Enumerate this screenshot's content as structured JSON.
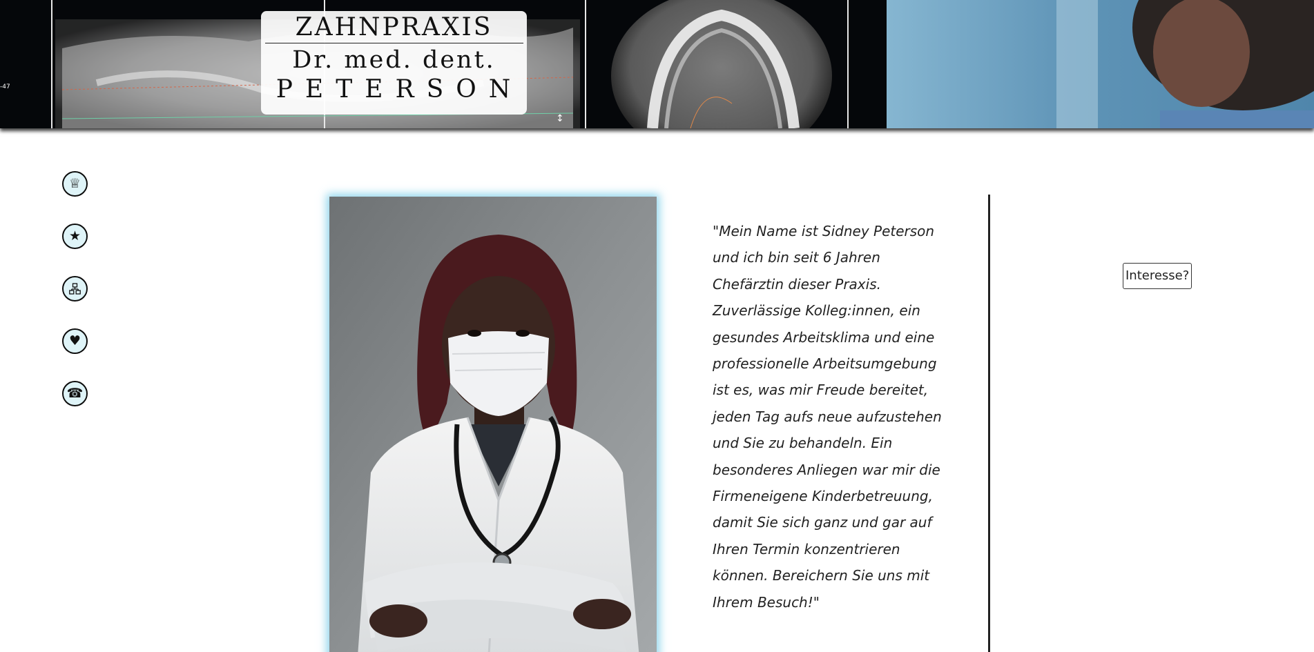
{
  "header": {
    "logo_line1": "ZAHNPRAXIS",
    "logo_line2": "Dr. med. dent.",
    "logo_line3": "PETERSON"
  },
  "sidenav": {
    "items": [
      {
        "icon": "crown-icon",
        "glyph": "♕"
      },
      {
        "icon": "star-icon",
        "glyph": "★"
      },
      {
        "icon": "network-icon",
        "glyph": "🖧"
      },
      {
        "icon": "heart-icon",
        "glyph": "♥"
      },
      {
        "icon": "telephone-icon",
        "glyph": "☎"
      }
    ]
  },
  "main": {
    "quote": "\"Mein Name ist Sidney Peterson und ich bin seit 6 Jahren Chefärztin dieser Praxis. Zuverlässige Kolleg:innen, ein gesundes Arbeitsklima und eine professionelle Arbeitsumgebung ist es, was mir Freude bereitet, jeden Tag aufs neue aufzustehen und Sie zu behandeln. Ein besonderes Anliegen war mir die Firmeneigene Kinderbetreuung, damit Sie sich ganz und gar auf Ihren Termin konzentrieren können. Bereichern Sie uns mit Ihrem Besuch!\"",
    "interest_button": "Interesse?"
  },
  "colors": {
    "icon_fill": "#dff4f8",
    "portrait_glow": "#6ec8e6",
    "banner_dark": "#05070a",
    "banner_blue": "#6b9cbc"
  }
}
